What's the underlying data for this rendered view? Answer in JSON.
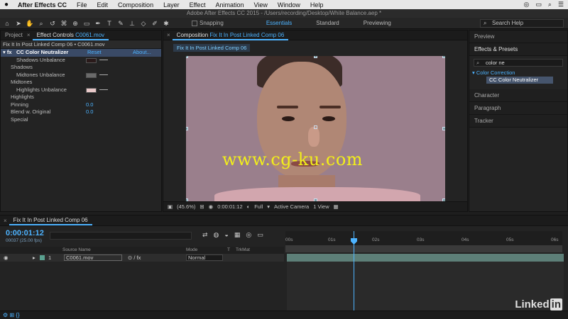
{
  "menubar": {
    "apple": "",
    "app_name": "After Effects CC",
    "items": [
      "File",
      "Edit",
      "Composition",
      "Layer",
      "Effect",
      "Animation",
      "View",
      "Window",
      "Help"
    ]
  },
  "title": "Adobe After Effects CC 2015 - /Users/recording/Desktop/White Balance.aep *",
  "toolbar": {
    "snapping_label": "Snapping",
    "workspaces": [
      "Essentials",
      "Standard",
      "Previewing"
    ],
    "search_help_placeholder": "Search Help"
  },
  "left_panel": {
    "tab_project": "Project",
    "tab_effect_controls": "Effect Controls",
    "tab_effect_controls_file": "C0061.mov",
    "header": "Fix It In Post Linked Comp 06 • C0061.mov",
    "effect_name": "CC Color Neutralizer",
    "reset_label": "Reset",
    "about_label": "About...",
    "properties": [
      {
        "label": "Shadows Unbalance",
        "type": "swatch",
        "color": "#2a1a1a"
      },
      {
        "label": "Shadows",
        "type": "group"
      },
      {
        "label": "Midtones Unbalance",
        "type": "swatch",
        "color": "#6a6a6a"
      },
      {
        "label": "Midtones",
        "type": "group"
      },
      {
        "label": "Highlights Unbalance",
        "type": "swatch",
        "color": "#e8c8c8"
      },
      {
        "label": "Highlights",
        "type": "group"
      },
      {
        "label": "Pinning",
        "type": "value",
        "value": "0.0"
      },
      {
        "label": "Blend w. Original",
        "type": "value",
        "value": "0.0"
      },
      {
        "label": "Special",
        "type": "group"
      }
    ]
  },
  "composition": {
    "tab_label": "Composition",
    "tab_comp_name": "Fix It In Post Linked Comp 06",
    "inner_tab": "Fix It In Post Linked Comp 06",
    "watermark": "www.cg-ku.com",
    "viewer_bar": {
      "zoom": "(45.6%)",
      "timecode": "0:00:01:12",
      "resolution": "Full",
      "camera": "Active Camera",
      "views": "1 View"
    }
  },
  "right_panel": {
    "preview_label": "Preview",
    "effects_presets_label": "Effects & Presets",
    "search_value": "color ne",
    "category": "Color Correction",
    "item": "CC Color Neutralizer",
    "sections": [
      "Character",
      "Paragraph",
      "Tracker"
    ]
  },
  "timeline": {
    "tab_label": "Fix It In Post Linked Comp 06",
    "current_time": "0:00:01:12",
    "frame_info": "00037 (25.00 fps)",
    "columns": {
      "source_name": "Source Name",
      "mode": "Mode",
      "t": "T",
      "trkmat": "TrkMat"
    },
    "ruler_ticks": [
      "00s",
      "01s",
      "02s",
      "03s",
      "04s",
      "05s",
      "06s"
    ],
    "layers": [
      {
        "index": "1",
        "source": "C0061.mov",
        "mode": "Normal"
      }
    ],
    "playhead_fraction": 0.245
  },
  "branding": {
    "linkedin_text": "Linked",
    "linkedin_in": "in"
  }
}
